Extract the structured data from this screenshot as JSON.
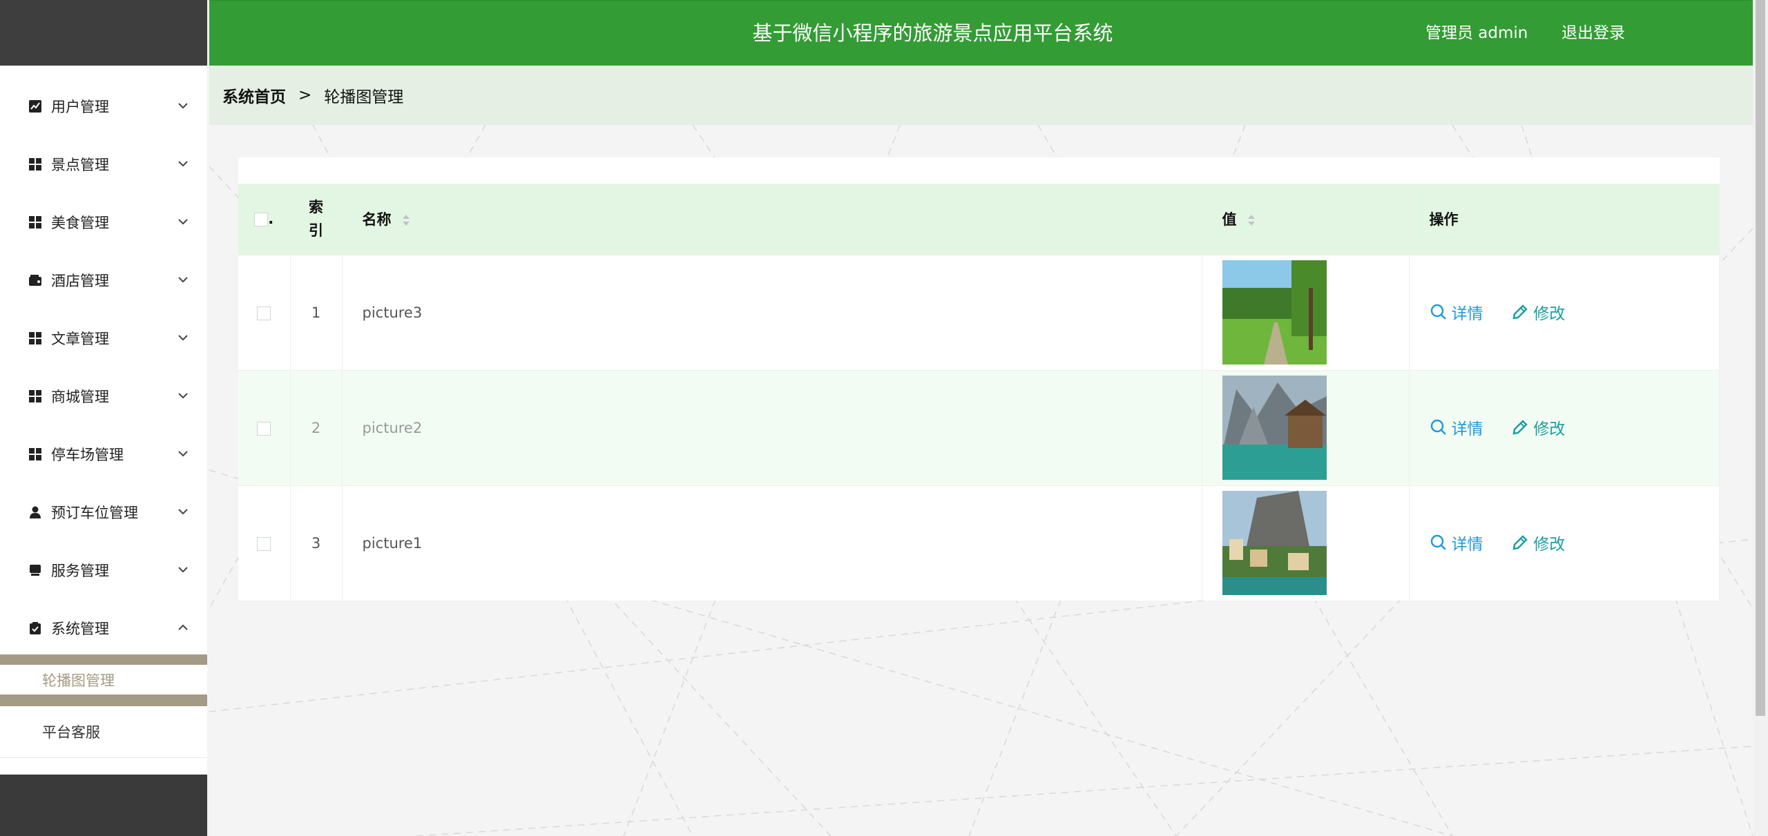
{
  "app": {
    "title": "基于微信小程序的旅游景点应用平台系统"
  },
  "header": {
    "user": "管理员 admin",
    "logout": "退出登录"
  },
  "breadcrumb": {
    "home": "系统首页",
    "separator": ">",
    "current": "轮播图管理"
  },
  "sidebar": {
    "items": [
      {
        "label": "用户管理",
        "icon": "chart-icon"
      },
      {
        "label": "景点管理",
        "icon": "grid-icon"
      },
      {
        "label": "美食管理",
        "icon": "grid-icon"
      },
      {
        "label": "酒店管理",
        "icon": "wallet-icon"
      },
      {
        "label": "文章管理",
        "icon": "grid-icon"
      },
      {
        "label": "商城管理",
        "icon": "grid-icon"
      },
      {
        "label": "停车场管理",
        "icon": "grid-icon"
      },
      {
        "label": "预订车位管理",
        "icon": "user-icon"
      },
      {
        "label": "服务管理",
        "icon": "service-icon"
      },
      {
        "label": "系统管理",
        "icon": "clipboard-icon"
      }
    ],
    "submenu": [
      {
        "label": "轮播图管理",
        "active": true
      },
      {
        "label": "平台客服",
        "active": false
      }
    ]
  },
  "table": {
    "headers": {
      "check": ".",
      "index": "索引",
      "name": "名称",
      "value": "值",
      "ops": "操作"
    },
    "rows": [
      {
        "index": "1",
        "name": "picture3"
      },
      {
        "index": "2",
        "name": "picture2"
      },
      {
        "index": "3",
        "name": "picture1"
      }
    ],
    "ops": {
      "detail": "详情",
      "edit": "修改"
    }
  },
  "colors": {
    "header": "#339c35",
    "breadcrumb_bg": "#e5efe4",
    "thead_bg": "#e3f6e3",
    "active_submenu": "#a59a85",
    "link_blue": "#1e9be0",
    "link_teal": "#1c9e9f"
  }
}
